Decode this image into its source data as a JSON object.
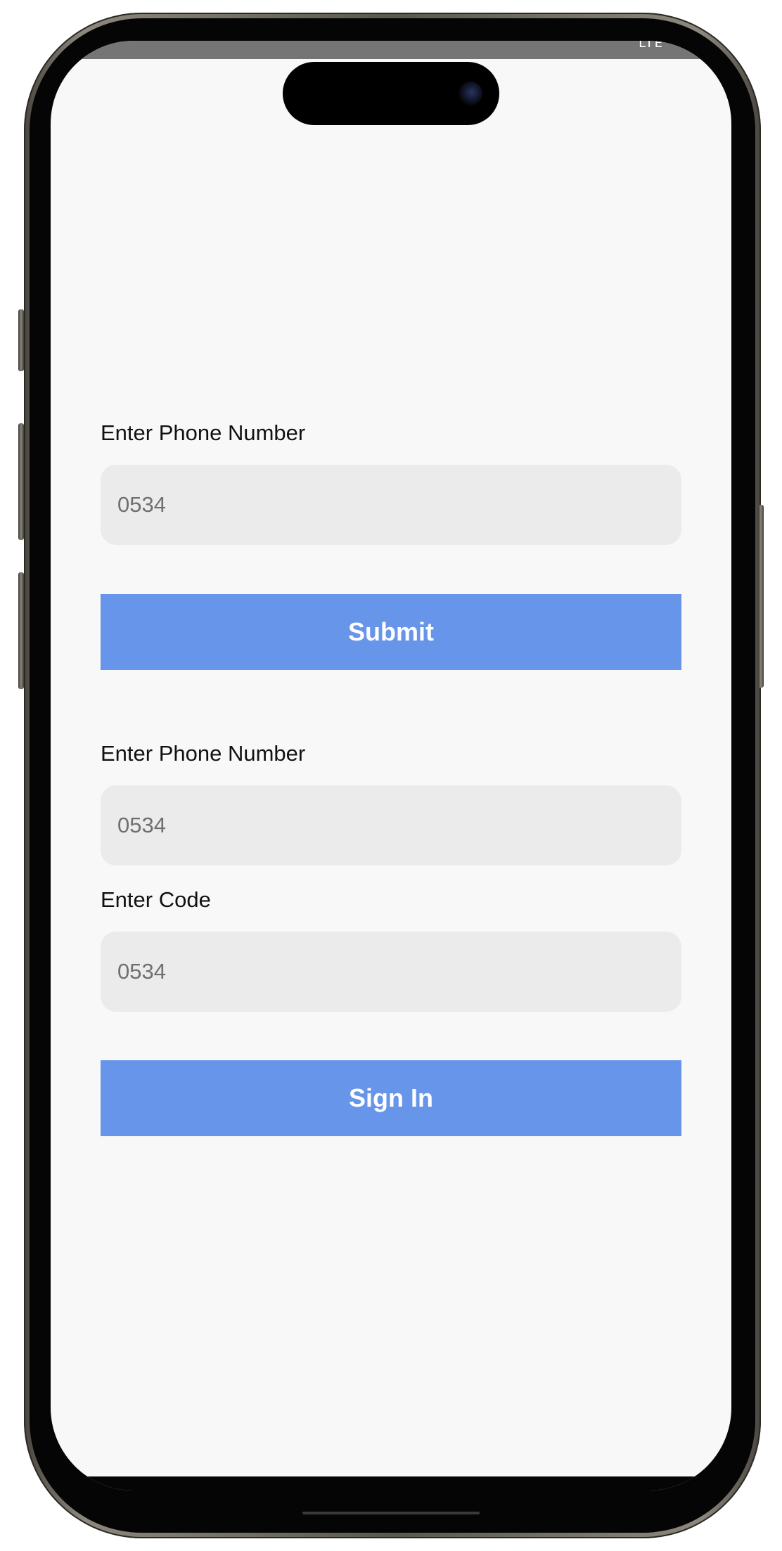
{
  "status_bar": {
    "indicator_text": "LTE"
  },
  "phone_form": {
    "label": "Enter Phone Number",
    "placeholder": "0534",
    "submit_label": "Submit"
  },
  "signin_form": {
    "phone_label": "Enter Phone Number",
    "phone_placeholder": "0534",
    "code_label": "Enter Code",
    "code_placeholder": "0534",
    "signin_label": "Sign In"
  },
  "colors": {
    "button": "#6795ea",
    "input_background": "#ebebeb",
    "screen_background": "#f8f8f8"
  }
}
